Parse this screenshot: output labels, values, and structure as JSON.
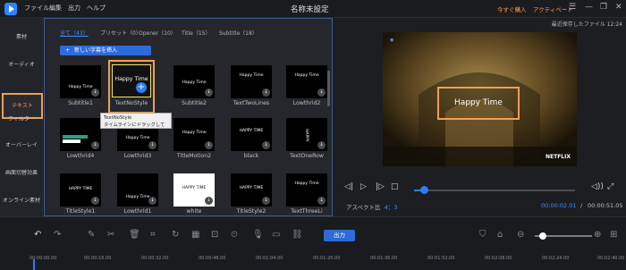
{
  "titlebar": {
    "menus": [
      "ファイル",
      "編集",
      "出力",
      "ヘルプ"
    ],
    "title": "名称未設定",
    "buy": "今すぐ購入",
    "activate": "アクティベート"
  },
  "sidebar": {
    "items": [
      "素材",
      "オーディオ",
      "テキスト",
      "フィルター",
      "オーバーレイ",
      "画面切替効果",
      "オンライン素材"
    ]
  },
  "library": {
    "tabs": [
      "全て（43）",
      "プリセット（0）",
      "Opener（10）",
      "Title（15）",
      "Subtitle（18）"
    ],
    "add_button": "新しい字幕を挿入",
    "tiles": [
      {
        "label": "Subtitle1",
        "text": "Happy Time"
      },
      {
        "label": "TextNoStyle",
        "text": "Happy Time"
      },
      {
        "label": "Subtitle2",
        "text": "Happy Time"
      },
      {
        "label": "TextTwoLines",
        "text": "Happy Time"
      },
      {
        "label": "Lowthrid2",
        "text": "Happy Time"
      },
      {
        "label": "Lowthrid4",
        "text": ""
      },
      {
        "label": "Lowthrid3",
        "text": "Happy Time"
      },
      {
        "label": "TitleMotion2",
        "text": "Happy Time"
      },
      {
        "label": "black",
        "text": "HAPPY TIME"
      },
      {
        "label": "TextOneRow",
        "text": "HAPPY"
      },
      {
        "label": "TitleStyle1",
        "text": "HAPPY TIME"
      },
      {
        "label": "Lowthrid1",
        "text": "Happy Time"
      },
      {
        "label": "white",
        "text": "HAPPY TIME"
      },
      {
        "label": "TitleStyle2",
        "text": "HAPPY TIME"
      },
      {
        "label": "TextThreeLi",
        "text": "Happy Time"
      }
    ],
    "tooltip_title": "TextNoStyle",
    "tooltip_hint": "タイムラインにドラッグして適用"
  },
  "preview": {
    "saved": "最近保存したファイル 12:24",
    "video_text": "Happy Time",
    "watermark": "NETFLIX",
    "aspect_label": "アスペクト比",
    "aspect_value": "4：3",
    "time_current": "00:00:02.01",
    "time_sep": "/",
    "time_total": "00:00:51.05",
    "progress": 0.06
  },
  "toolbar": {
    "output": "出力"
  },
  "ruler": {
    "ticks": [
      "00:00:00.00",
      "00:00:16.00",
      "00:00:32.00",
      "00:00:48.00",
      "00:01:04.00",
      "00:01:20.00",
      "00:01:36.00",
      "00:01:52.00",
      "00:02:08.00",
      "00:02:24.00",
      "00:02:40.00"
    ]
  },
  "colors": {
    "accent": "#2d7cf0",
    "highlight": "#f0a050",
    "orange_text": "#ff9a3c"
  }
}
